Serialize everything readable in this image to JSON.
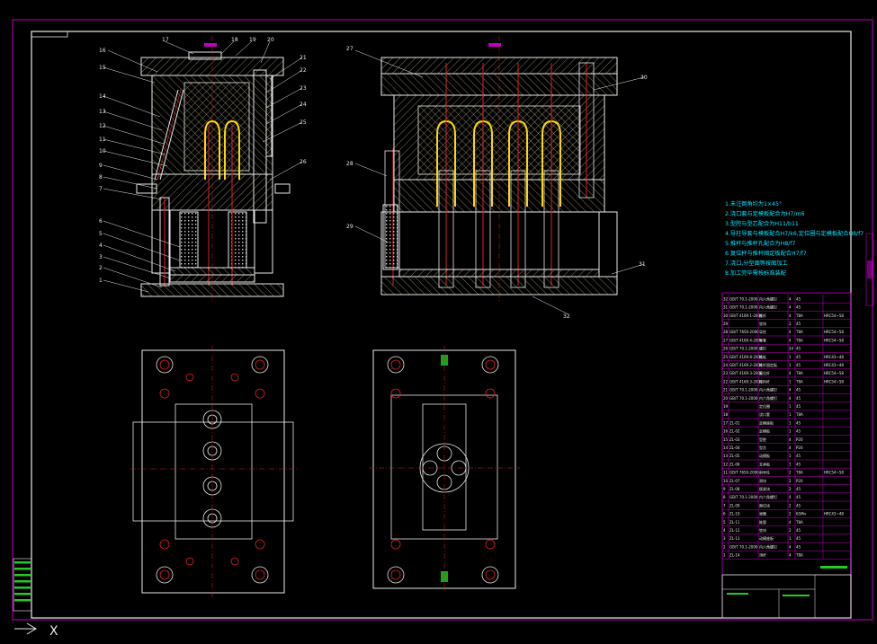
{
  "drawing": {
    "background": "#000000",
    "frame_color": "#c000c0",
    "line_color": "#e8e8e8",
    "hatch_color": "#d8d0a0",
    "core_color": "#ffd700",
    "cavity_color": "#e02020",
    "text_color": "#00e5ff"
  },
  "balloons_left": [
    "16",
    "17",
    "18",
    "19",
    "20",
    "21",
    "22",
    "23",
    "24",
    "25",
    "26",
    "15",
    "14",
    "13",
    "12",
    "11",
    "10",
    "9",
    "8",
    "7",
    "6",
    "5",
    "4",
    "3",
    "2",
    "1"
  ],
  "balloons_right": [
    "27",
    "30",
    "28",
    "29",
    "31",
    "32"
  ],
  "notes": [
    "1.未注倒角均为1×45°",
    "2.浇口套与定模板配合为H7/m6",
    "3.型腔与型芯配合为H11/b11",
    "4.导柱导套与模板配合H7/k6,定位圈与定模板配合H8/f7",
    "5.推杆与推杆孔配合为H8/f7",
    "6.复位杆与推杆固定板配合H7/f7",
    "7.浇口,分型面等按图加工",
    "8.加工完毕需按标准装配"
  ],
  "bom_rows": [
    {
      "no": "32",
      "code": "GB/T 70.1-2000",
      "name": "内六角螺钉",
      "qty": "4",
      "mat": "45",
      "note": ""
    },
    {
      "no": "31",
      "code": "GB/T 70.1-2000",
      "name": "内六角螺钉",
      "qty": "4",
      "mat": "45",
      "note": ""
    },
    {
      "no": "30",
      "code": "GB/T 4169.1-2006",
      "name": "推杆",
      "qty": "4",
      "mat": "T8A",
      "note": "HRC54~58"
    },
    {
      "no": "29",
      "code": "",
      "name": "垫块",
      "qty": "2",
      "mat": "45",
      "note": ""
    },
    {
      "no": "28",
      "code": "GB/T 7650-2006",
      "name": "导柱",
      "qty": "4",
      "mat": "T8A",
      "note": "HRC54~58"
    },
    {
      "no": "27",
      "code": "GB/T 4169.4-2006",
      "name": "导套",
      "qty": "4",
      "mat": "T8A",
      "note": "HRC54~58"
    },
    {
      "no": "26",
      "code": "GB/T 70.1-2000",
      "name": "螺钉",
      "qty": "24",
      "mat": "45",
      "note": ""
    },
    {
      "no": "25",
      "code": "GB/T 4169.8-2006",
      "name": "推板",
      "qty": "1",
      "mat": "45",
      "note": "HRC43~48"
    },
    {
      "no": "24",
      "code": "GB/T 4169.2-2006",
      "name": "推杆固定板",
      "qty": "1",
      "mat": "45",
      "note": "HRC43~48"
    },
    {
      "no": "23",
      "code": "GB/T 4169.3-2006",
      "name": "复位杆",
      "qty": "4",
      "mat": "T8A",
      "note": "HRC54~58"
    },
    {
      "no": "22",
      "code": "GB/T 4169.3-2006",
      "name": "拉料杆",
      "qty": "1",
      "mat": "T8A",
      "note": "HRC54~58"
    },
    {
      "no": "21",
      "code": "GB/T 70.1-2000",
      "name": "内六角螺钉",
      "qty": "4",
      "mat": "45",
      "note": ""
    },
    {
      "no": "20",
      "code": "GB/T 70.1-2000",
      "name": "内六角螺钉",
      "qty": "4",
      "mat": "45",
      "note": ""
    },
    {
      "no": "19",
      "code": "",
      "name": "定位圈",
      "qty": "1",
      "mat": "45",
      "note": ""
    },
    {
      "no": "18",
      "code": "",
      "name": "浇口套",
      "qty": "1",
      "mat": "T8A",
      "note": ""
    },
    {
      "no": "17",
      "code": "ZL-01",
      "name": "定模座板",
      "qty": "1",
      "mat": "45",
      "note": ""
    },
    {
      "no": "16",
      "code": "ZL-02",
      "name": "定模板",
      "qty": "1",
      "mat": "45",
      "note": ""
    },
    {
      "no": "15",
      "code": "ZL-03",
      "name": "型腔",
      "qty": "4",
      "mat": "P20",
      "note": ""
    },
    {
      "no": "14",
      "code": "ZL-04",
      "name": "型芯",
      "qty": "4",
      "mat": "P20",
      "note": ""
    },
    {
      "no": "13",
      "code": "ZL-05",
      "name": "动模板",
      "qty": "1",
      "mat": "45",
      "note": ""
    },
    {
      "no": "12",
      "code": "ZL-06",
      "name": "支承板",
      "qty": "1",
      "mat": "45",
      "note": ""
    },
    {
      "no": "11",
      "code": "GB/T 7650-2006",
      "name": "斜导柱",
      "qty": "2",
      "mat": "T8A",
      "note": "HRC54~58"
    },
    {
      "no": "10",
      "code": "ZL-07",
      "name": "滑块",
      "qty": "2",
      "mat": "P20",
      "note": ""
    },
    {
      "no": "9",
      "code": "ZL-08",
      "name": "楔紧块",
      "qty": "2",
      "mat": "45",
      "note": ""
    },
    {
      "no": "8",
      "code": "GB/T 70.1-2000",
      "name": "内六角螺钉",
      "qty": "4",
      "mat": "45",
      "note": ""
    },
    {
      "no": "7",
      "code": "ZL-09",
      "name": "限位块",
      "qty": "2",
      "mat": "45",
      "note": ""
    },
    {
      "no": "6",
      "code": "ZL-10",
      "name": "弹簧",
      "qty": "2",
      "mat": "65Mn",
      "note": "HRC43~48"
    },
    {
      "no": "5",
      "code": "ZL-11",
      "name": "推管",
      "qty": "4",
      "mat": "T8A",
      "note": ""
    },
    {
      "no": "4",
      "code": "ZL-12",
      "name": "垫块",
      "qty": "2",
      "mat": "45",
      "note": ""
    },
    {
      "no": "3",
      "code": "ZL-13",
      "name": "动模座板",
      "qty": "1",
      "mat": "45",
      "note": ""
    },
    {
      "no": "2",
      "code": "GB/T 70.1-2000",
      "name": "内六角螺钉",
      "qty": "4",
      "mat": "45",
      "note": ""
    },
    {
      "no": "1",
      "code": "ZL-14",
      "name": "顶杆",
      "qty": "4",
      "mat": "T8A",
      "note": ""
    }
  ],
  "ucs_label": "X"
}
